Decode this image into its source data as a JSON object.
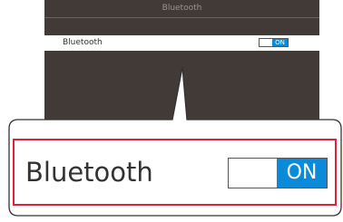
{
  "device_screen": {
    "title": "Bluetooth",
    "row_label": "Bluetooth",
    "toggle_state": "ON"
  },
  "callout": {
    "label": "Bluetooth",
    "toggle_state": "ON",
    "highlight_color": "#e0203a"
  },
  "colors": {
    "screen_bg": "#413a37",
    "toggle_on": "#0a8ad8"
  }
}
